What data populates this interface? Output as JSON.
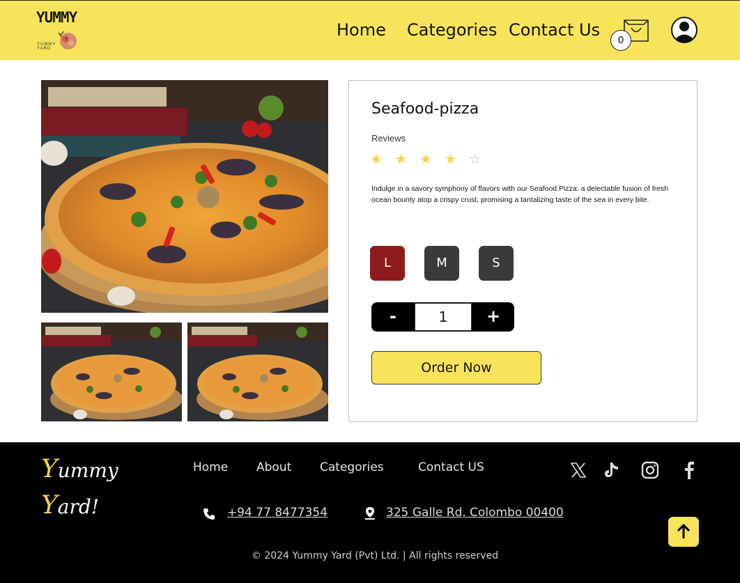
{
  "header": {
    "logo": {
      "word": "YUMMY",
      "sub_line1": "YUMMY",
      "sub_line2": "YARD"
    },
    "nav": {
      "home": "Home",
      "categories": "Categories",
      "contact": "Contact Us"
    },
    "cart_count": "0",
    "cart_icon": "shopping-bag-icon",
    "profile_icon": "user-avatar-icon"
  },
  "product": {
    "title": "Seafood-pizza",
    "reviews_label": "Reviews",
    "rating": 4,
    "rating_max": 5,
    "stars_filled": "★ ★ ★ ★",
    "stars_empty": "☆",
    "description": "Indulge in a savory symphony of flavors with our Seafood Pizza: a delectable fusion of fresh ocean bounty atop a crispy crust, promising a tantalizing taste of the sea in every bite.",
    "sizes": [
      "L",
      "M",
      "S"
    ],
    "selected_size": "L",
    "quantity": {
      "minus": "-",
      "value": "1",
      "plus": "+"
    },
    "order_button": "Order Now"
  },
  "footer": {
    "brand_y1": "Y",
    "brand_rest1": "ummy",
    "brand_y2": "Y",
    "brand_rest2": "ard!",
    "links": [
      "Home",
      "About",
      "Categories",
      "Contact US"
    ],
    "phone": "+94 77 8477354",
    "address": "325 Galle Rd, Colombo 00400",
    "copyright": "© 2024 Yummy Yard (Pvt) Ltd. | All rights reserved",
    "social": [
      "x-icon",
      "tiktok-icon",
      "instagram-icon",
      "facebook-icon"
    ]
  },
  "colors": {
    "accent_yellow": "#f8e45a",
    "selected_size": "#8e1b1b",
    "size_button": "#3a3a3a",
    "footer_bg": "#000000"
  }
}
